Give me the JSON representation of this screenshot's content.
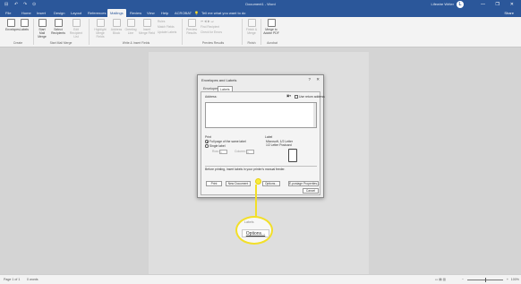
{
  "titlebar": {
    "quick_access": [
      "⊟",
      "↶",
      "↷",
      "⊙"
    ],
    "document_title": "Document1 - Word",
    "user_name": "Lifewire Writer",
    "badge": "L",
    "window_controls": [
      "—",
      "❐",
      "✕"
    ]
  },
  "tabs": [
    "File",
    "Home",
    "Insert",
    "Design",
    "Layout",
    "References",
    "Mailings",
    "Review",
    "View",
    "Help",
    "ACROBAT"
  ],
  "active_tab": "Mailings",
  "tell_me": "Tell me what you want to do",
  "share": "Share",
  "ribbon": {
    "create": {
      "envelopes": "Envelopes",
      "labels": "Labels",
      "group": "Create"
    },
    "start_mail_merge": {
      "start": "Start Mail Merge",
      "select": "Select Recipients",
      "edit": "Edit Recipient List",
      "group": "Start Mail Merge"
    },
    "write_insert": {
      "highlight": "Highlight Merge Fields",
      "address_block": "Address Block",
      "greeting": "Greeting Line",
      "insert_field": "Insert Merge Field",
      "rules": "Rules",
      "match": "Match Fields",
      "update": "Update Labels",
      "group": "Write & Insert Fields"
    },
    "preview": {
      "preview": "Preview Results",
      "find": "Find Recipient",
      "check": "Check for Errors",
      "group": "Preview Results"
    },
    "finish": {
      "finish": "Finish & Merge",
      "group": "Finish"
    },
    "acrobat": {
      "merge": "Merge to Adobe PDF",
      "group": "Acrobat"
    }
  },
  "dialog": {
    "title": "Envelopes and Labels",
    "help": "?",
    "close": "✕",
    "tabs": [
      "Envelopes",
      "Labels"
    ],
    "active_tab": "Labels",
    "address_label": "Address:",
    "use_return": "Use return address",
    "print_label": "Print",
    "full_page": "Full page of the same label",
    "single_label": "Single label",
    "row_label": "Row:",
    "row_value": "1",
    "column_label": "Column:",
    "column_value": "1",
    "label_header": "Label",
    "label_line1": "Microsoft, 1/2 Letter",
    "label_line2": "1/2 Letter Postcard",
    "note": "Before printing, insert labels in your printer's manual feeder.",
    "buttons": {
      "print": "Print",
      "new_document": "New Document",
      "options": "Options...",
      "epostage": "E-postage Properties...",
      "cancel": "Cancel"
    }
  },
  "callout": {
    "above": "Labels",
    "button": "Options..."
  },
  "statusbar": {
    "page": "Page 1 of 1",
    "words": "0 words",
    "zoom": "100%"
  }
}
